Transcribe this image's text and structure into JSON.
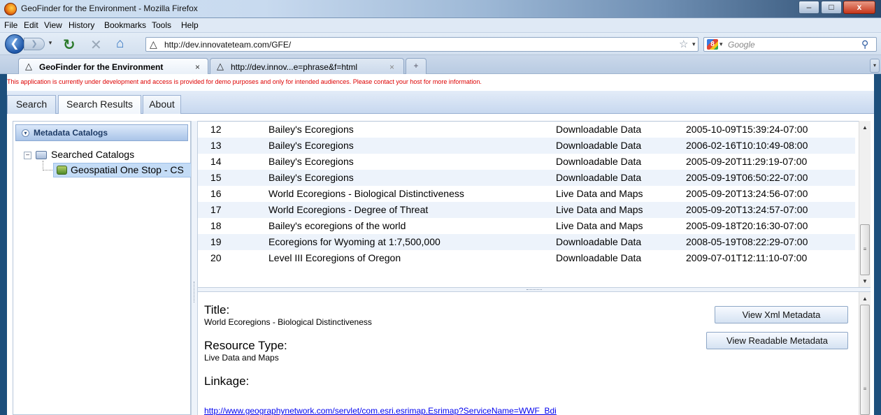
{
  "window": {
    "title": "GeoFinder for the Environment - Mozilla Firefox",
    "minimize_glyph": "–",
    "maximize_glyph": "□",
    "close_glyph": "x"
  },
  "menu": [
    "File",
    "Edit",
    "View",
    "History",
    "Bookmarks",
    "Tools",
    "Help"
  ],
  "nav": {
    "url": "http://dev.innovateteam.com/GFE/",
    "search_placeholder": "Google",
    "back_glyph": "❮",
    "forward_glyph": "❯",
    "dropdown_glyph": "▾",
    "reload_glyph": "↻",
    "stop_glyph": "✕",
    "home_glyph": "⌂",
    "site_glyph": "△",
    "star_glyph": "☆",
    "search_engine_glyph": "8",
    "magnifier_glyph": "⚲"
  },
  "browser_tabs": [
    {
      "label": "GeoFinder for the Environment",
      "active": true
    },
    {
      "label": "http://dev.innov...e=phrase&f=html",
      "active": false
    }
  ],
  "tab_close_glyph": "×",
  "tab_new_glyph": "+",
  "tab_list_glyph": "▾",
  "app": {
    "notice": "This application is currently under development and access is provided for demo purposes and only for intended audiences. Please contact your host for more information.",
    "tabs": [
      "Search",
      "Search Results",
      "About"
    ],
    "active_tab": "Search Results"
  },
  "catalogs": {
    "header": "Metadata Catalogs",
    "toggle_glyph": "▾",
    "root": "Searched Catalogs",
    "root_expander": "−",
    "child": "Geospatial One Stop - CS"
  },
  "results": {
    "rows": [
      {
        "num": "12",
        "title": "Bailey's Ecoregions",
        "type": "Downloadable Data",
        "date": "2005-10-09T15:39:24-07:00"
      },
      {
        "num": "13",
        "title": "Bailey's Ecoregions",
        "type": "Downloadable Data",
        "date": "2006-02-16T10:10:49-08:00"
      },
      {
        "num": "14",
        "title": "Bailey's Ecoregions",
        "type": "Downloadable Data",
        "date": "2005-09-20T11:29:19-07:00"
      },
      {
        "num": "15",
        "title": "Bailey's Ecoregions",
        "type": "Downloadable Data",
        "date": "2005-09-19T06:50:22-07:00"
      },
      {
        "num": "16",
        "title": "World Ecoregions - Biological Distinctiveness",
        "type": "Live Data and Maps",
        "date": "2005-09-20T13:24:56-07:00"
      },
      {
        "num": "17",
        "title": "World Ecoregions - Degree of Threat",
        "type": "Live Data and Maps",
        "date": "2005-09-20T13:24:57-07:00"
      },
      {
        "num": "18",
        "title": "Bailey's ecoregions of the world",
        "type": "Live Data and Maps",
        "date": "2005-09-18T20:16:30-07:00"
      },
      {
        "num": "19",
        "title": "Ecoregions for Wyoming at 1:7,500,000",
        "type": "Downloadable Data",
        "date": "2008-05-19T08:22:29-07:00"
      },
      {
        "num": "20",
        "title": "Level III Ecoregions of Oregon",
        "type": "Downloadable Data",
        "date": "2009-07-01T12:11:10-07:00"
      }
    ]
  },
  "detail": {
    "title_label": "Title:",
    "title_value": "World Ecoregions - Biological Distinctiveness",
    "resource_label": "Resource Type:",
    "resource_value": "Live Data and Maps",
    "linkage_label": "Linkage:",
    "linkage_value": "http://www.geographynetwork.com/servlet/com.esri.esrimap.Esrimap?ServiceName=WWF_Bdi",
    "btn_xml": "View Xml Metadata",
    "btn_readable": "View Readable Metadata"
  },
  "scroll": {
    "up": "▲",
    "down": "▼",
    "grip": "≡"
  },
  "colors": {
    "notice": "#dd0000",
    "link": "#0000ee",
    "selection": "#c4dcf6",
    "row_alt": "#edf3fb"
  }
}
